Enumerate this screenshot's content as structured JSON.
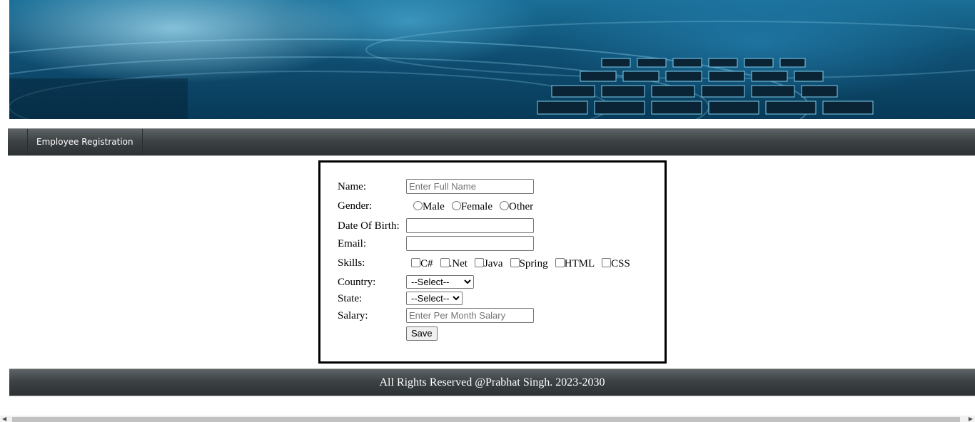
{
  "nav": {
    "items": [
      "Employee Registration"
    ]
  },
  "form": {
    "name_label": "Name:",
    "name_placeholder": "Enter Full Name",
    "name_value": "",
    "gender_label": "Gender:",
    "gender_options": [
      "Male",
      "Female",
      "Other"
    ],
    "dob_label": "Date Of Birth:",
    "dob_value": "",
    "email_label": "Email:",
    "email_value": "",
    "skills_label": "Skills:",
    "skills": [
      "C#",
      ".Net",
      "Java",
      "Spring",
      "HTML",
      "CSS"
    ],
    "country_label": "Country:",
    "country_selected": "--Select--",
    "state_label": "State:",
    "state_selected": "--Select--",
    "salary_label": "Salary:",
    "salary_placeholder": "Enter Per Month Salary",
    "salary_value": "",
    "save_label": "Save"
  },
  "footer": {
    "text": "All Rights Reserved @Prabhat Singh. 2023-2030"
  },
  "icons": {
    "scroll_left": "chevron-left-icon",
    "scroll_right": "chevron-right-icon"
  }
}
